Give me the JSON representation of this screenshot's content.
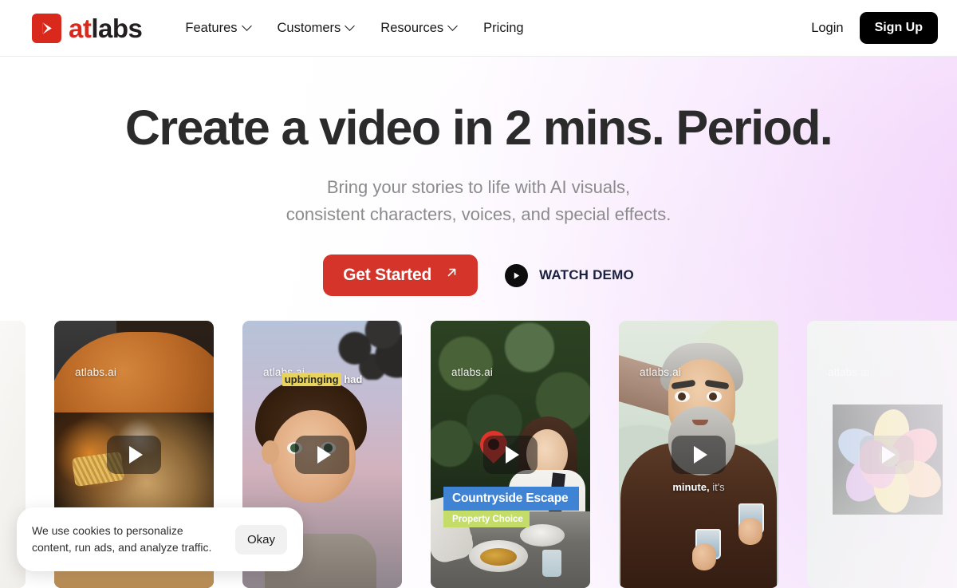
{
  "header": {
    "logo": {
      "mark": "play-logo-icon",
      "text_primary": "at",
      "text_secondary": "labs"
    },
    "nav": [
      {
        "label": "Features",
        "has_chevron": true
      },
      {
        "label": "Customers",
        "has_chevron": true
      },
      {
        "label": "Resources",
        "has_chevron": true
      },
      {
        "label": "Pricing",
        "has_chevron": false
      }
    ],
    "login_label": "Login",
    "signup_label": "Sign Up"
  },
  "hero": {
    "headline": "Create a video in 2 mins. Period.",
    "subtitle_line1": "Bring your stories to life with AI visuals,",
    "subtitle_line2": "consistent characters, voices, and special effects.",
    "cta_primary": "Get Started",
    "cta_primary_icon": "arrow-up-right-icon",
    "cta_secondary": "WATCH DEMO",
    "cta_secondary_icon": "play-circle-icon"
  },
  "carousel": {
    "cards": [
      {
        "id": "card-edge-left",
        "watermark": "",
        "caption": "",
        "caption_sub": ""
      },
      {
        "id": "card-food",
        "watermark": "atlabs.ai",
        "caption": "",
        "caption_sub": ""
      },
      {
        "id": "card-animated-boy",
        "watermark": "atlabs.ai",
        "caption_highlight": "upbringing",
        "caption": "had",
        "caption_sub": ""
      },
      {
        "id": "card-countryside",
        "watermark": "atlabs.ai",
        "caption": "Countryside Escape",
        "caption_sub": "Property Choice"
      },
      {
        "id": "card-elder",
        "watermark": "atlabs.ai",
        "caption": "minute,",
        "caption_dim": "it's",
        "caption_sub": ""
      },
      {
        "id": "card-pinwheel",
        "watermark": "atlabs.ai",
        "caption": "",
        "caption_sub": ""
      }
    ]
  },
  "cookie_banner": {
    "text": "We use cookies to personalize content, run ads, and analyze traffic.",
    "accept_label": "Okay"
  },
  "colors": {
    "brand_red": "#d9291c",
    "cta_red": "#d4342a",
    "dark": "#000000",
    "banner_blue": "#3f83d4",
    "banner_green": "#c3dd68",
    "highlight_yellow": "#e8d45c",
    "accent_glow": "#f0cdfa"
  }
}
